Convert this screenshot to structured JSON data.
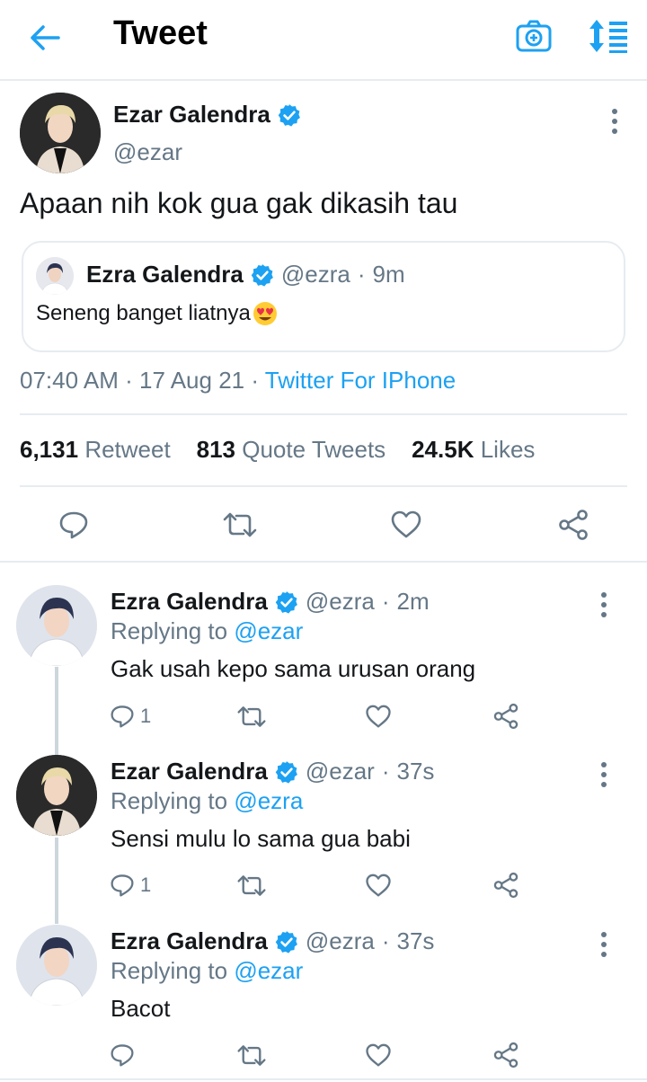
{
  "header": {
    "title": "Tweet",
    "icons": [
      "back-arrow-icon",
      "camera-plus-icon",
      "sort-icon"
    ]
  },
  "main_tweet": {
    "name": "Ezar Galendra",
    "handle": "@ezar",
    "text": "Apaan nih kok gua gak dikasih tau",
    "quote": {
      "name": "Ezra Galendra",
      "handle": "@ezra",
      "dot": "·",
      "time": "9m",
      "text": "Seneng banget liatnya",
      "emoji": "😍"
    },
    "meta": {
      "time": "07:40 AM",
      "dot1": "·",
      "date": "17 Aug 21",
      "dot2": "·",
      "source": "Twitter For IPhone"
    },
    "stats": {
      "retweets": "6,131",
      "retweets_label": "Retweet",
      "quotes": "813",
      "quotes_label": "Quote Tweets",
      "likes": "24.5K",
      "likes_label": "Likes"
    }
  },
  "replies": [
    {
      "name": "Ezra Galendra",
      "handle": "@ezra",
      "dot": "·",
      "time": "2m",
      "replying_label": "Replying to",
      "replying_to": "@ezar",
      "text": "Gak usah kepo sama urusan orang",
      "reply_count": "1"
    },
    {
      "name": "Ezar Galendra",
      "handle": "@ezar",
      "dot": "·",
      "time": "37s",
      "replying_label": "Replying to",
      "replying_to": "@ezra",
      "text": "Sensi mulu lo sama gua babi",
      "reply_count": "1"
    },
    {
      "name": "Ezra Galendra",
      "handle": "@ezra",
      "dot": "·",
      "time": "37s",
      "replying_label": "Replying to",
      "replying_to": "@ezar",
      "text": "Bacot",
      "reply_count": ""
    }
  ],
  "colors": {
    "accent": "#1da1f2",
    "text": "#14171a",
    "secondary": "#657786",
    "divider": "#e6ecf0"
  }
}
